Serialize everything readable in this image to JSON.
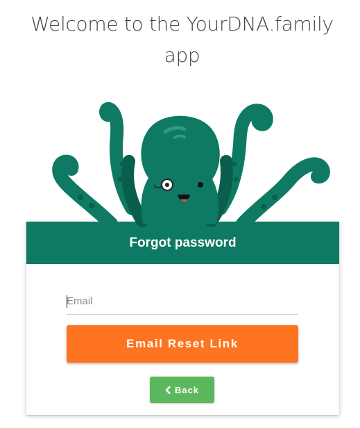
{
  "header": {
    "welcome_text": "Welcome to the YourDNA.family app"
  },
  "mascot": {
    "icon": "octopus-mascot-icon",
    "body_color": "#0e7a63",
    "accent_color": "#0a5f4c"
  },
  "form": {
    "title": "Forgot password",
    "email_placeholder": "Email",
    "email_value": "",
    "reset_button_label": "Email Reset Link",
    "back_button_label": "Back",
    "back_icon": "chevron-left-icon"
  },
  "colors": {
    "header_bg": "#0e7a63",
    "primary_button": "#ff7421",
    "back_button": "#5cb85c"
  }
}
